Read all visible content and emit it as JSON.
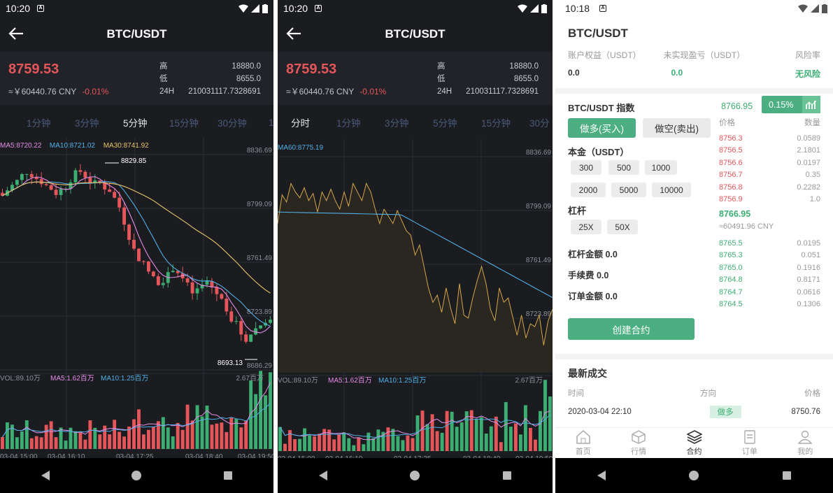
{
  "panel_kline": {
    "status_time": "10:20",
    "title": "BTC/USDT",
    "price": "8759.53",
    "cny": "≈￥60440.76 CNY",
    "change": "-0.01%",
    "stats": {
      "high_label": "高",
      "high": "18880.0",
      "low_label": "低",
      "low": "8655.0",
      "vol_label": "24H",
      "vol": "210031117.7328691"
    },
    "tabs": [
      "1分钟",
      "3分钟",
      "5分钟",
      "15分钟",
      "30分钟",
      "1"
    ],
    "active_tab": "5分钟",
    "ma_labels": [
      "MA5:8720.22",
      "MA10:8721.02",
      "MA30:8741.92"
    ],
    "y_ticks": [
      "8836.69",
      "8799.09",
      "8761.49",
      "8723.89",
      "8686.29"
    ],
    "max_label": "8829.85",
    "min_label": "8693.13",
    "vol_labels": [
      "VOL:89.10万",
      "MA5:1.62百万",
      "MA10:1.25百万"
    ],
    "vol_max": "2.67百万",
    "x_ticks": [
      "03-04 15:00",
      "03-04 16:10",
      "03-04 17:25",
      "03-04 18:40",
      "03-04 19:50"
    ]
  },
  "panel_line": {
    "status_time": "10:20",
    "title": "BTC/USDT",
    "price": "8759.53",
    "cny": "≈￥60440.76 CNY",
    "change": "-0.01%",
    "stats": {
      "high_label": "高",
      "high": "18880.0",
      "low_label": "低",
      "low": "8655.0",
      "vol_label": "24H",
      "vol": "210031117.7328691"
    },
    "tabs": [
      "分时",
      "1分钟",
      "3分钟",
      "5分钟",
      "15分钟",
      "30分"
    ],
    "active_tab": "分时",
    "ma_labels": [
      "MA60:8775.19"
    ],
    "y_ticks": [
      "8836.69",
      "8799.09",
      "8761.49",
      "8723.89",
      "8686.29"
    ],
    "vol_labels": [
      "VOL:89.10万",
      "MA5:1.62百万",
      "MA10:1.25百万"
    ],
    "vol_max": "2.67百万",
    "x_ticks": [
      "03-04 15:00",
      "03-04 16:10",
      "03-04 17:25",
      "03-04 18:40",
      "03-04 19:50"
    ]
  },
  "panel_trade": {
    "status_time": "10:18",
    "title": "BTC/USDT",
    "account": {
      "labels": [
        "账户权益（USDT）",
        "未实现盈亏（USDT）",
        "风险率"
      ],
      "values": [
        "0.0",
        "0.0",
        "无风险"
      ]
    },
    "index_label": "BTC/USDT 指数",
    "index_value": "8766.95",
    "index_change": "0.15%",
    "buy_label": "做多(买入)",
    "sell_label": "做空(卖出)",
    "principal_label": "本金（USDT）",
    "amounts": [
      "300",
      "500",
      "1000",
      "2000",
      "5000",
      "10000"
    ],
    "leverage_label": "杠杆",
    "leverages": [
      "25X",
      "50X"
    ],
    "lever_amount": "杠杆金额 0.0",
    "fee": "手续费 0.0",
    "order_amount": "订单金额 0.0",
    "create_label": "创建合约",
    "book": {
      "price_header": "价格",
      "qty_header": "数量",
      "asks": [
        [
          "8756.3",
          "0.0589"
        ],
        [
          "8756.5",
          "2.1801"
        ],
        [
          "8756.6",
          "0.0197"
        ],
        [
          "8756.7",
          "0.35"
        ],
        [
          "8756.8",
          "0.2282"
        ],
        [
          "8756.9",
          "1.0"
        ]
      ],
      "mid": "8766.95",
      "mid_cny": "≈60491.96 CNY",
      "bids": [
        [
          "8765.5",
          "0.0195"
        ],
        [
          "8765.3",
          "0.051"
        ],
        [
          "8765.0",
          "0.1916"
        ],
        [
          "8764.8",
          "0.8171"
        ],
        [
          "8764.7",
          "0.0616"
        ],
        [
          "8764.5",
          "0.1306"
        ]
      ]
    },
    "trades": {
      "title": "最新成交",
      "headers": [
        "时间",
        "方向",
        "价格"
      ],
      "rows": [
        [
          "2020-03-04  22:10",
          "做多",
          "8750.76"
        ]
      ]
    },
    "tabbar": [
      "首页",
      "行情",
      "合约",
      "订单",
      "我的"
    ],
    "active_tabbar": "合约"
  },
  "colors": {
    "up": "#3cae72",
    "down": "#e5565b",
    "bg_dark": "#1b1c20",
    "accent": "#4caf82",
    "ma5": "#e58ce8",
    "ma10": "#4fb0e6",
    "ma30": "#e6c36a"
  }
}
